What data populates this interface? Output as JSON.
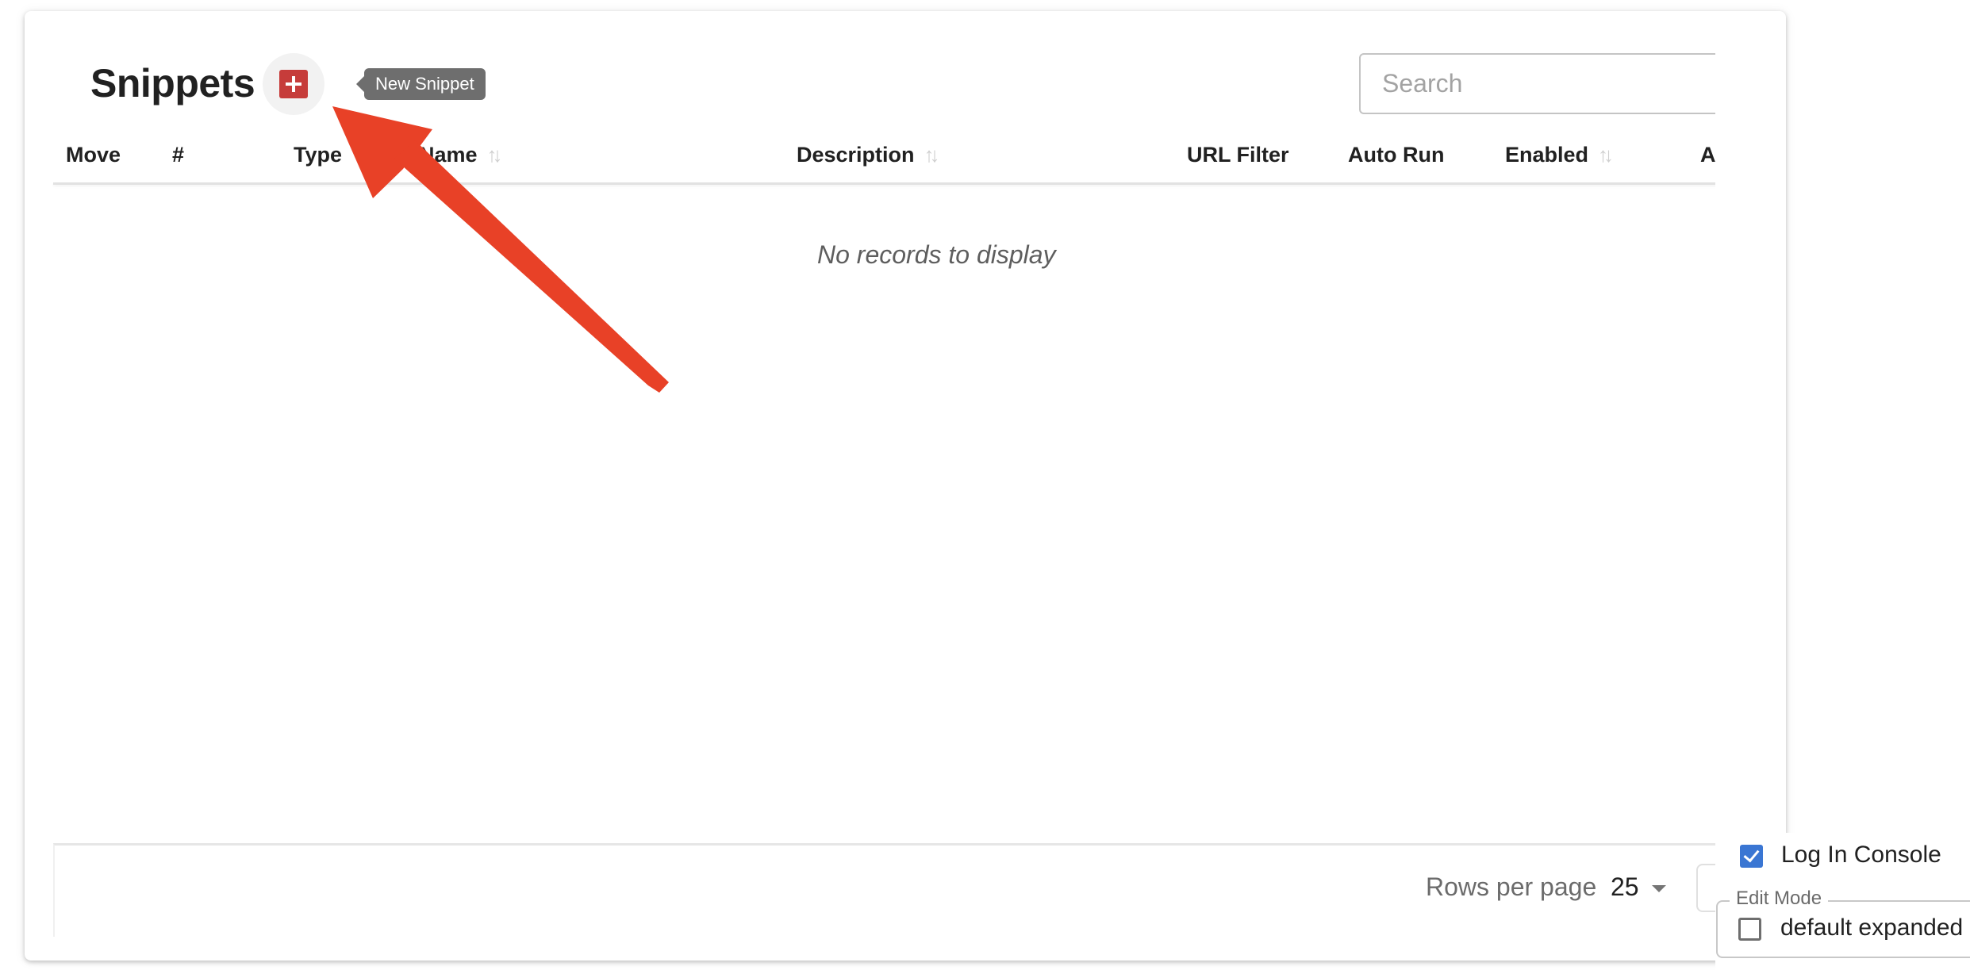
{
  "page": {
    "title": "Snippets",
    "add_button": {
      "icon": "plus-square-icon",
      "tooltip": "New Snippet",
      "color": "#c63c3a"
    },
    "search": {
      "placeholder": "Search",
      "value": ""
    }
  },
  "table": {
    "columns": [
      {
        "label": "Move",
        "sortable": false
      },
      {
        "label": "#",
        "sortable": false
      },
      {
        "label": "Type",
        "sortable": false
      },
      {
        "label": "Name",
        "sortable": true
      },
      {
        "label": "Description",
        "sortable": true
      },
      {
        "label": "URL Filter",
        "sortable": false
      },
      {
        "label": "Auto Run",
        "sortable": false
      },
      {
        "label": "Enabled",
        "sortable": true
      },
      {
        "label": "A",
        "sortable": false
      }
    ],
    "sort_icon": "↑↓",
    "rows": [],
    "empty_message": "No records to display"
  },
  "pagination": {
    "rows_per_page_label": "Rows per page",
    "rows_per_page_value": "25"
  },
  "settings_panel": {
    "log_in_console": {
      "label": "Log In Console",
      "checked": true
    },
    "edit_mode": {
      "legend": "Edit Mode",
      "default_expanded": {
        "label": "default expanded",
        "checked": false
      }
    },
    "accent_color": "#3a76d3"
  },
  "annotation": {
    "type": "arrow",
    "points_to": "new-snippet-button",
    "color": "#e84127"
  }
}
